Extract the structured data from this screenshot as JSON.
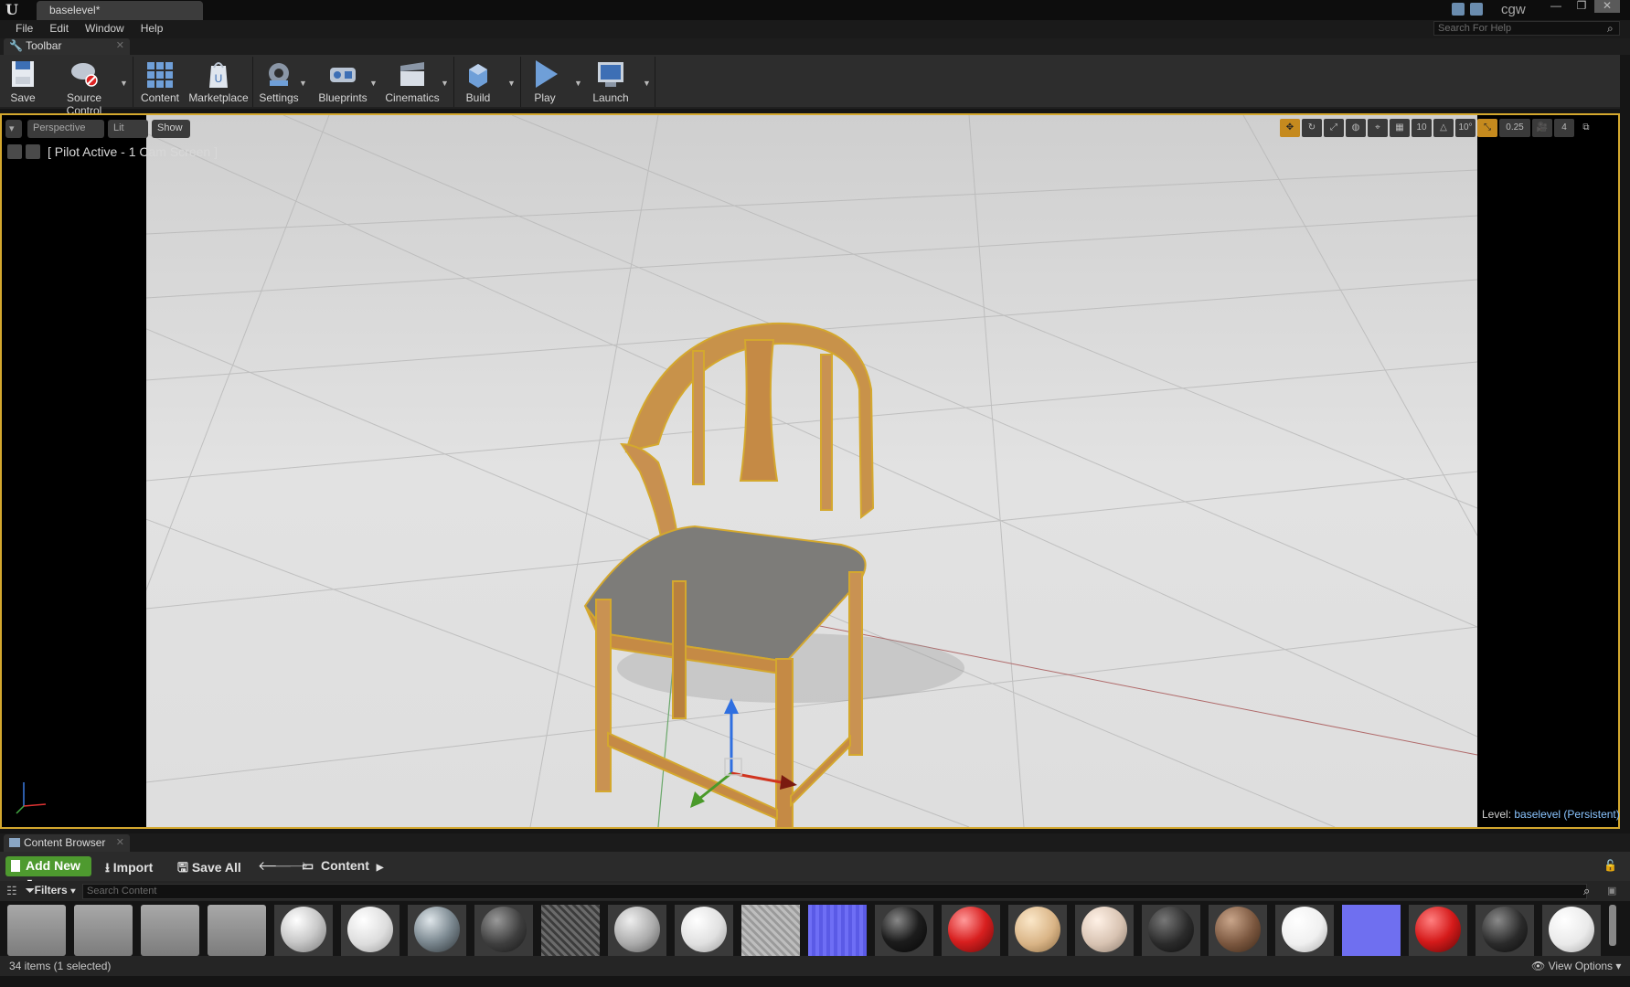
{
  "window": {
    "tab_title": "baselevel*",
    "user": "cgw"
  },
  "menu": {
    "items": [
      "File",
      "Edit",
      "Window",
      "Help"
    ],
    "help_search_placeholder": "Search For Help"
  },
  "toolbar": {
    "tab_label": "Toolbar",
    "buttons": [
      "Save",
      "Source Control",
      "Content",
      "Marketplace",
      "Settings",
      "Blueprints",
      "Cinematics",
      "Build",
      "Play",
      "Launch"
    ]
  },
  "viewport": {
    "view_mode": "Perspective",
    "lit_mode": "Lit",
    "show_label": "Show",
    "pilot_text": "[ Pilot Active - 1 Cam Screen ]",
    "grid_value": "10",
    "angle_value": "10°",
    "scale_value": "0.25",
    "cam_speed": "4",
    "level_prefix": "Level:",
    "level_name": "baselevel (Persistent)"
  },
  "content_browser": {
    "tab_label": "Content Browser",
    "add_new_label": "Add New",
    "import_label": "Import",
    "save_all_label": "Save All",
    "path_label": "Content",
    "filters_label": "Filters",
    "search_placeholder": "Search Content",
    "status_text": "34 items (1 selected)",
    "view_options_label": "View Options"
  },
  "colors": {
    "selection_outline": "#d4a82e",
    "add_new_green": "#4e9a2f",
    "accent_blue": "#8ac4ff"
  }
}
